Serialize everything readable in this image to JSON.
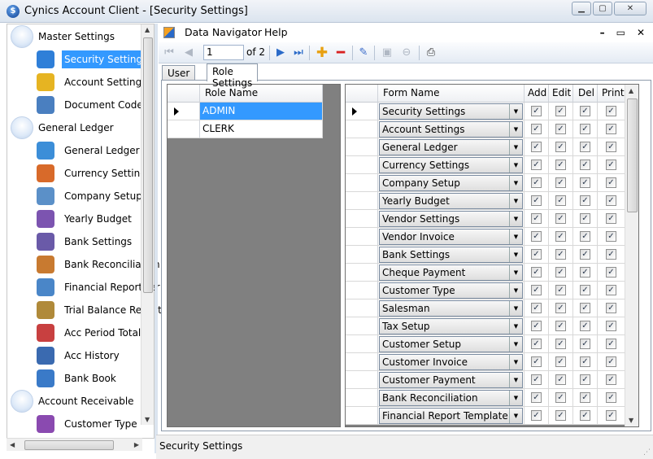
{
  "window": {
    "title": "Cynics Account Client - [Security Settings]",
    "buttons": {
      "minimize": "▁",
      "maximize": "▢",
      "close": "✕"
    }
  },
  "sidebar": {
    "items": [
      {
        "type": "group",
        "label": "Master Settings"
      },
      {
        "type": "leaf",
        "label": "Security Settings",
        "icon": "user-key-icon",
        "color": "#2f7fd8",
        "selected": true
      },
      {
        "type": "leaf",
        "label": "Account Settings",
        "icon": "dollar-icon",
        "color": "#e6b422"
      },
      {
        "type": "leaf",
        "label": "Document Code",
        "icon": "document-icon",
        "color": "#4a7fc0"
      },
      {
        "type": "group",
        "label": "General Ledger"
      },
      {
        "type": "leaf",
        "label": "General Ledger",
        "icon": "ledger-icon",
        "color": "#3c8ed8"
      },
      {
        "type": "leaf",
        "label": "Currency Settings",
        "icon": "currency-icon",
        "color": "#d86a2a"
      },
      {
        "type": "leaf",
        "label": "Company Setup",
        "icon": "company-icon",
        "color": "#5b90c8"
      },
      {
        "type": "leaf",
        "label": "Yearly Budget",
        "icon": "budget-icon",
        "color": "#7c54b0"
      },
      {
        "type": "leaf",
        "label": "Bank Settings",
        "icon": "bank-icon",
        "color": "#6a5aa8"
      },
      {
        "type": "leaf",
        "label": "Bank Reconciliation",
        "icon": "reconcile-icon",
        "color": "#c87a30"
      },
      {
        "type": "leaf",
        "label": "Financial Report Ter",
        "icon": "report-icon",
        "color": "#4a86c8"
      },
      {
        "type": "leaf",
        "label": "Trial Balance Report",
        "icon": "scale-icon",
        "color": "#b08a3a"
      },
      {
        "type": "leaf",
        "label": "Acc Period Total",
        "icon": "calendar-icon",
        "color": "#c84040"
      },
      {
        "type": "leaf",
        "label": "Acc History",
        "icon": "history-icon",
        "color": "#3a6ab0"
      },
      {
        "type": "leaf",
        "label": "Bank Book",
        "icon": "book-icon",
        "color": "#3a7ac8"
      },
      {
        "type": "group",
        "label": "Account Receivable"
      },
      {
        "type": "leaf",
        "label": "Customer Type",
        "icon": "customers-icon",
        "color": "#8a4ab0"
      }
    ]
  },
  "menu": {
    "items": [
      "Data Navigator",
      "Help"
    ],
    "mdi": {
      "minimize": "–",
      "restore": "▭",
      "close": "✕"
    }
  },
  "navigator": {
    "position": "1",
    "of_label": "of 2"
  },
  "tabs": [
    {
      "label": "User Info",
      "active": false
    },
    {
      "label": "Role Settings",
      "active": true
    }
  ],
  "roles_grid": {
    "header": "Role Name",
    "rows": [
      {
        "name": "ADMIN",
        "selected": true
      },
      {
        "name": "CLERK",
        "selected": false
      }
    ]
  },
  "permissions_grid": {
    "headers": {
      "form": "Form Name",
      "add": "Add",
      "edit": "Edit",
      "del": "Del",
      "print": "Print"
    },
    "rows": [
      {
        "form": "Security Settings",
        "add": true,
        "edit": true,
        "del": true,
        "print": true
      },
      {
        "form": "Account Settings",
        "add": true,
        "edit": true,
        "del": true,
        "print": true
      },
      {
        "form": "General Ledger",
        "add": true,
        "edit": true,
        "del": true,
        "print": true
      },
      {
        "form": "Currency Settings",
        "add": true,
        "edit": true,
        "del": true,
        "print": true
      },
      {
        "form": "Company Setup",
        "add": true,
        "edit": true,
        "del": true,
        "print": true
      },
      {
        "form": "Yearly Budget",
        "add": true,
        "edit": true,
        "del": true,
        "print": true
      },
      {
        "form": "Vendor Settings",
        "add": true,
        "edit": true,
        "del": true,
        "print": true
      },
      {
        "form": "Vendor Invoice",
        "add": true,
        "edit": true,
        "del": true,
        "print": true
      },
      {
        "form": "Bank Settings",
        "add": true,
        "edit": true,
        "del": true,
        "print": true
      },
      {
        "form": "Cheque Payment",
        "add": true,
        "edit": true,
        "del": true,
        "print": true
      },
      {
        "form": "Customer Type",
        "add": true,
        "edit": true,
        "del": true,
        "print": true
      },
      {
        "form": "Salesman",
        "add": true,
        "edit": true,
        "del": true,
        "print": true
      },
      {
        "form": "Tax Setup",
        "add": true,
        "edit": true,
        "del": true,
        "print": true
      },
      {
        "form": "Customer Setup",
        "add": true,
        "edit": true,
        "del": true,
        "print": true
      },
      {
        "form": "Customer Invoice",
        "add": true,
        "edit": true,
        "del": true,
        "print": true
      },
      {
        "form": "Customer Payment",
        "add": true,
        "edit": true,
        "del": true,
        "print": true
      },
      {
        "form": "Bank Reconciliation",
        "add": true,
        "edit": true,
        "del": true,
        "print": true
      },
      {
        "form": "Financial Report Template",
        "add": true,
        "edit": true,
        "del": true,
        "print": true
      }
    ]
  },
  "status": {
    "text": "Security Settings"
  }
}
